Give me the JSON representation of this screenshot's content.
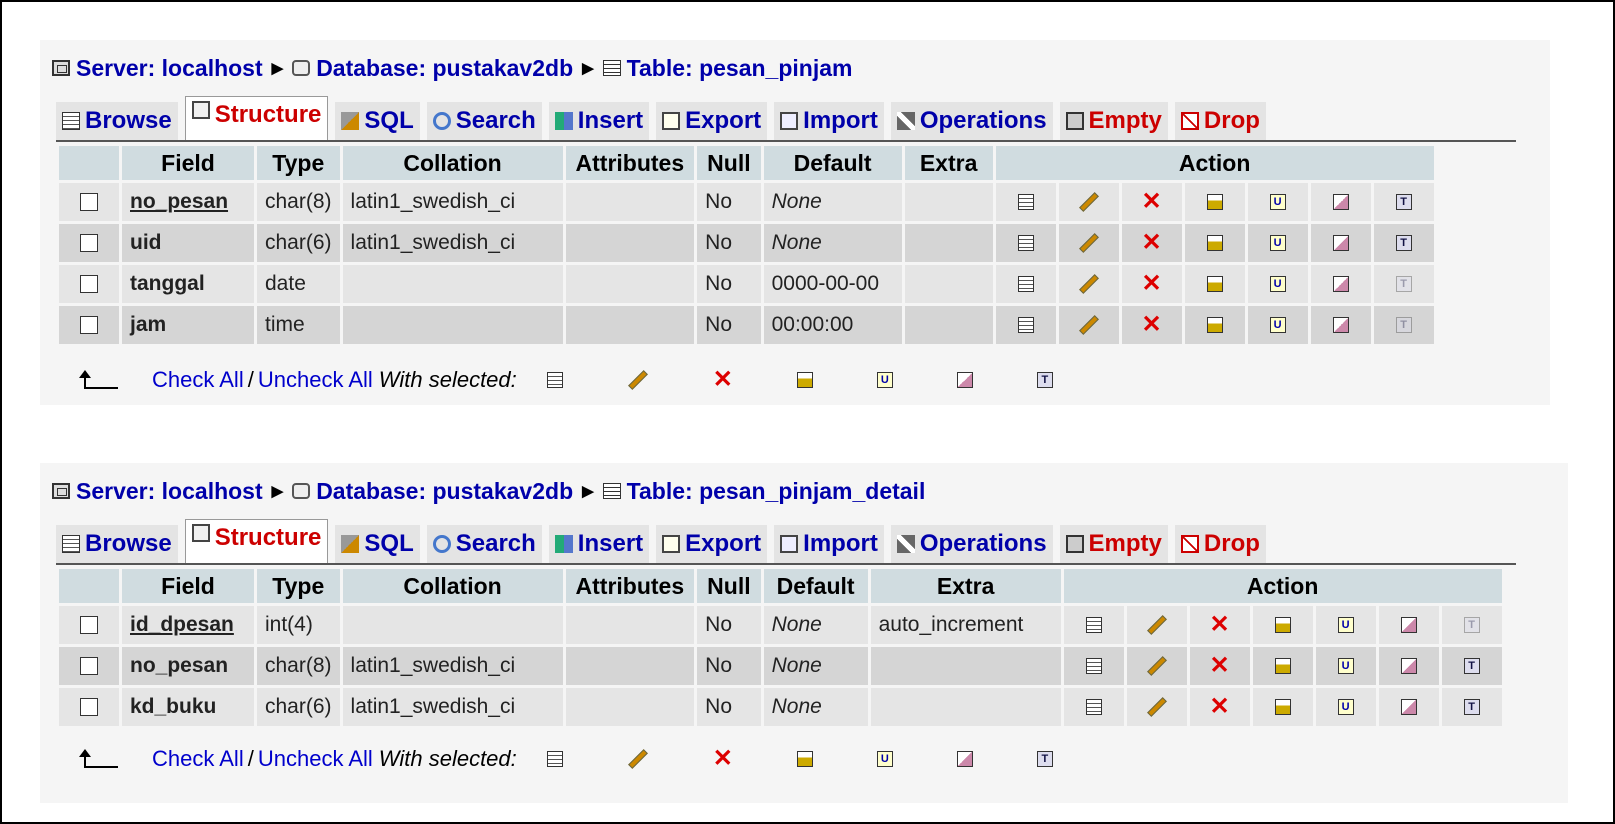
{
  "tabs": [
    "Browse",
    "Structure",
    "SQL",
    "Search",
    "Insert",
    "Export",
    "Import",
    "Operations",
    "Empty",
    "Drop"
  ],
  "footer": {
    "check_all": "Check All",
    "separator": "/",
    "uncheck_all": "Uncheck All",
    "with_selected": "With selected:"
  },
  "panels": [
    {
      "breadcrumb": {
        "server": "Server: localhost",
        "database": "Database: pustakav2db",
        "table": "Table: pesan_pinjam"
      },
      "columns": [
        "Field",
        "Type",
        "Collation",
        "Attributes",
        "Null",
        "Default",
        "Extra",
        "Action"
      ],
      "rows": [
        {
          "field": "no_pesan",
          "type": "char(8)",
          "collation": "latin1_swedish_ci",
          "attributes": "",
          "null": "No",
          "default": "None",
          "extra": "",
          "primary": true
        },
        {
          "field": "uid",
          "type": "char(6)",
          "collation": "latin1_swedish_ci",
          "attributes": "",
          "null": "No",
          "default": "None",
          "extra": "",
          "primary": false
        },
        {
          "field": "tanggal",
          "type": "date",
          "collation": "",
          "attributes": "",
          "null": "No",
          "default": "0000-00-00",
          "extra": "",
          "primary": false
        },
        {
          "field": "jam",
          "type": "time",
          "collation": "",
          "attributes": "",
          "null": "No",
          "default": "00:00:00",
          "extra": "",
          "primary": false
        }
      ]
    },
    {
      "breadcrumb": {
        "server": "Server: localhost",
        "database": "Database: pustakav2db",
        "table": "Table: pesan_pinjam_detail"
      },
      "columns": [
        "Field",
        "Type",
        "Collation",
        "Attributes",
        "Null",
        "Default",
        "Extra",
        "Action"
      ],
      "rows": [
        {
          "field": "id_dpesan",
          "type": "int(4)",
          "collation": "",
          "attributes": "",
          "null": "No",
          "default": "None",
          "extra": "auto_increment",
          "primary": true
        },
        {
          "field": "no_pesan",
          "type": "char(8)",
          "collation": "latin1_swedish_ci",
          "attributes": "",
          "null": "No",
          "default": "None",
          "extra": "",
          "primary": false
        },
        {
          "field": "kd_buku",
          "type": "char(6)",
          "collation": "latin1_swedish_ci",
          "attributes": "",
          "null": "No",
          "default": "None",
          "extra": "",
          "primary": false
        }
      ]
    }
  ]
}
